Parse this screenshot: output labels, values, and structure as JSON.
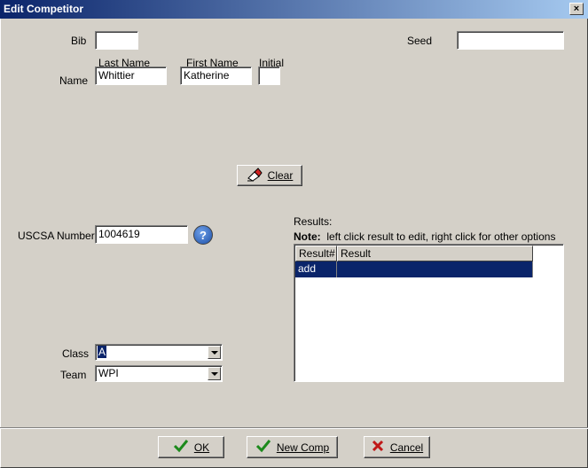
{
  "window": {
    "title": "Edit Competitor",
    "close_glyph": "×"
  },
  "fields": {
    "bib": {
      "label": "Bib",
      "value": ""
    },
    "seed": {
      "label": "Seed",
      "value": ""
    },
    "name": {
      "label": "Name",
      "last_name_label": "Last Name",
      "last_name": "Whittier",
      "first_name_label": "First Name",
      "first_name": "Katherine",
      "initial_label": "Initial",
      "initial": ""
    },
    "uscsa": {
      "label": "USCSA Number",
      "value": "1004619",
      "help_glyph": "?"
    },
    "class": {
      "label": "Class",
      "value": "A"
    },
    "team": {
      "label": "Team",
      "value": "WPI"
    }
  },
  "clear_button": {
    "label": "Clear",
    "icon": "eraser-icon"
  },
  "results": {
    "heading": "Results:",
    "note_bold": "Note:",
    "note_text": "left click result to edit, right click for other options",
    "columns": [
      "Result#",
      "Result"
    ],
    "rows": [
      {
        "result_num": "add",
        "result": ""
      }
    ]
  },
  "footer": {
    "ok": {
      "label": "OK",
      "icon": "checkmark-icon"
    },
    "new_comp": {
      "label": "New Comp",
      "icon": "checkmark-icon"
    },
    "cancel": {
      "label": "Cancel",
      "icon": "red-x-icon"
    }
  },
  "colors": {
    "title_start": "#0a246a",
    "title_end": "#a6caf0",
    "selection": "#0a246a",
    "dialog_bg": "#d4d0c8"
  }
}
